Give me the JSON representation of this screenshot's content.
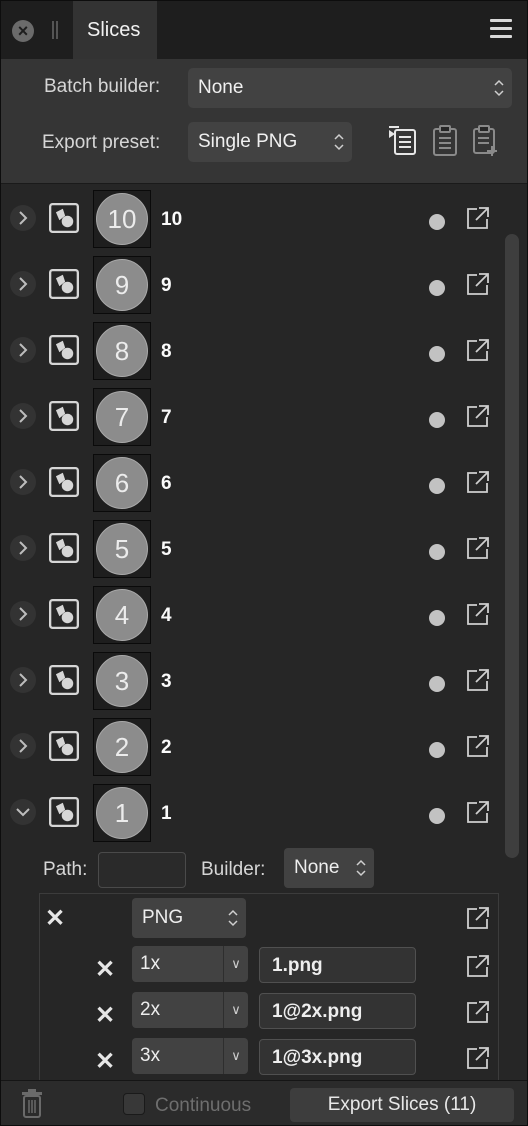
{
  "tab": {
    "title": "Slices"
  },
  "header": {
    "batch_builder_label": "Batch builder:",
    "batch_builder_value": "None",
    "export_preset_label": "Export preset:",
    "export_preset_value": "Single PNG"
  },
  "icons": {
    "close": "close-icon",
    "menu": "hamburger-menu-icon",
    "preset_list": "preset-list-icon",
    "preset_copy": "clipboard-icon",
    "preset_add": "clipboard-add-icon",
    "slice": "slice-shape-icon",
    "export_single": "export-arrow-icon",
    "trash": "trash-icon"
  },
  "slices": [
    {
      "thumb": "10",
      "name": "10",
      "expanded": false
    },
    {
      "thumb": "9",
      "name": "9",
      "expanded": false
    },
    {
      "thumb": "8",
      "name": "8",
      "expanded": false
    },
    {
      "thumb": "7",
      "name": "7",
      "expanded": false
    },
    {
      "thumb": "6",
      "name": "6",
      "expanded": false
    },
    {
      "thumb": "5",
      "name": "5",
      "expanded": false
    },
    {
      "thumb": "4",
      "name": "4",
      "expanded": false
    },
    {
      "thumb": "3",
      "name": "3",
      "expanded": false
    },
    {
      "thumb": "2",
      "name": "2",
      "expanded": false
    },
    {
      "thumb": "1",
      "name": "1",
      "expanded": true
    }
  ],
  "details": {
    "path_label": "Path:",
    "path_value": "",
    "builder_label": "Builder:",
    "builder_value": "None",
    "format": "PNG",
    "scales": [
      {
        "scale": "1x",
        "filename": "1.png"
      },
      {
        "scale": "2x",
        "filename": "1@2x.png"
      },
      {
        "scale": "3x",
        "filename": "1@3x.png"
      }
    ]
  },
  "footer": {
    "continuous_label": "Continuous",
    "continuous_checked": false,
    "export_button": "Export Slices (11)"
  },
  "colors": {
    "panel_bg": "#262626",
    "header_bg": "#353535",
    "field_bg": "#424242",
    "thumb_circle": "#8c8c8c"
  }
}
